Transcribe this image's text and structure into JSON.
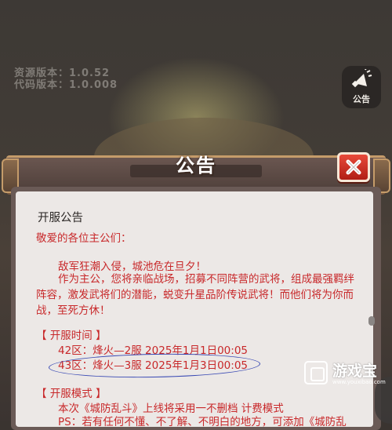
{
  "hud": {
    "res_version": "资源版本：1.0.52",
    "code_version": "代码版本：1.0.008",
    "notice_button_label": "公告"
  },
  "dialog": {
    "title": "公告",
    "heading": "开服公告",
    "greeting": "敬爱的各位主公们：",
    "para1": "敌军狂潮入侵，城池危在旦夕！",
    "para2": "作为主公，您将亲临战场，招募不同阵营的武将，组成最强羁绊阵容，激发武将们的潜能，蜕变升星品阶传说武将！而他们将为你而战，至死方休！",
    "section_time": "【 开服时间 】",
    "servers": [
      "42区：烽火—2服 2025年1月1日00:05",
      "43区：烽火—3服 2025年1月3日00:05"
    ],
    "section_mode": "【 开服模式 】",
    "mode_line": "本次《城防乱斗》上线将采用一不删档 计费模式",
    "mode_line2": "PS：若有任何不懂、不了解、不明白的地方，可添加《城防乱"
  },
  "watermark": {
    "cn": "游戏宝",
    "en": "www.youxibao.com"
  },
  "colors": {
    "accent_red": "#c8282a",
    "close_red": "#d0302a",
    "annotation_blue": "#3a4ab4"
  }
}
